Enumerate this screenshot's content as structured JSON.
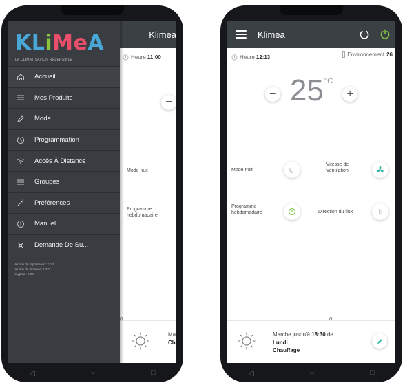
{
  "left_screen": {
    "app_title": "Klimea",
    "heure_label": "Heure",
    "heure_value": "11:00",
    "minus_label": "−",
    "mode_nuit_label": "Mode nuit",
    "programme_label": "Programme hebdomadaire",
    "zero_label": "0",
    "status_line1": "Marc",
    "status_line2": "Chau",
    "logo": {
      "letters": [
        "K",
        "L",
        "i",
        "M",
        "e",
        "A"
      ],
      "colors": [
        "#49a7d6",
        "#49a7d6",
        "#8cc63f",
        "#e94e6b",
        "#e94e6b",
        "#49a7d6"
      ]
    },
    "tagline": "LA CLIMATISATION RÉVERSIBLE",
    "menu": [
      {
        "label": "Accueil",
        "icon": "home-icon"
      },
      {
        "label": "Mes Produits",
        "icon": "list-icon"
      },
      {
        "label": "Mode",
        "icon": "pencil-icon"
      },
      {
        "label": "Programmation",
        "icon": "clock-icon"
      },
      {
        "label": "Accès À Distance",
        "icon": "wifi-icon"
      },
      {
        "label": "Groupes",
        "icon": "list-icon"
      },
      {
        "label": "Préférences",
        "icon": "wand-icon"
      },
      {
        "label": "Manuel",
        "icon": "info-icon"
      },
      {
        "label": "Demande De Su...",
        "icon": "support-icon"
      }
    ],
    "version": {
      "app": "Version de l'application: 2.0.1",
      "firmware": "Version du firmware: 1.3.1",
      "keypass": "Keypass: 2.0.0"
    }
  },
  "right_screen": {
    "app_title": "Klimea",
    "heure_label": "Heure",
    "heure_value": "12:13",
    "env_label": "Environnement",
    "env_value": "26",
    "temperature": "25",
    "temperature_unit": "°C",
    "minus_label": "−",
    "plus_label": "+",
    "mode_nuit_label": "Mode nuit",
    "vitesse_label": "Vitesse de ventilation",
    "programme_label": "Programme hebdomadaire",
    "direction_label": "Direction du flux",
    "zero_label": "0",
    "status_prefix": "Marche jusqu'à",
    "status_time": "18:30",
    "status_suffix": "de",
    "status_day": "Lundi",
    "status_mode": "Chauffage"
  },
  "colors": {
    "appbar": "#3b4045",
    "drawer": "#393c40",
    "accent_green": "#7ac143",
    "accent_teal": "#2bb3a0"
  }
}
